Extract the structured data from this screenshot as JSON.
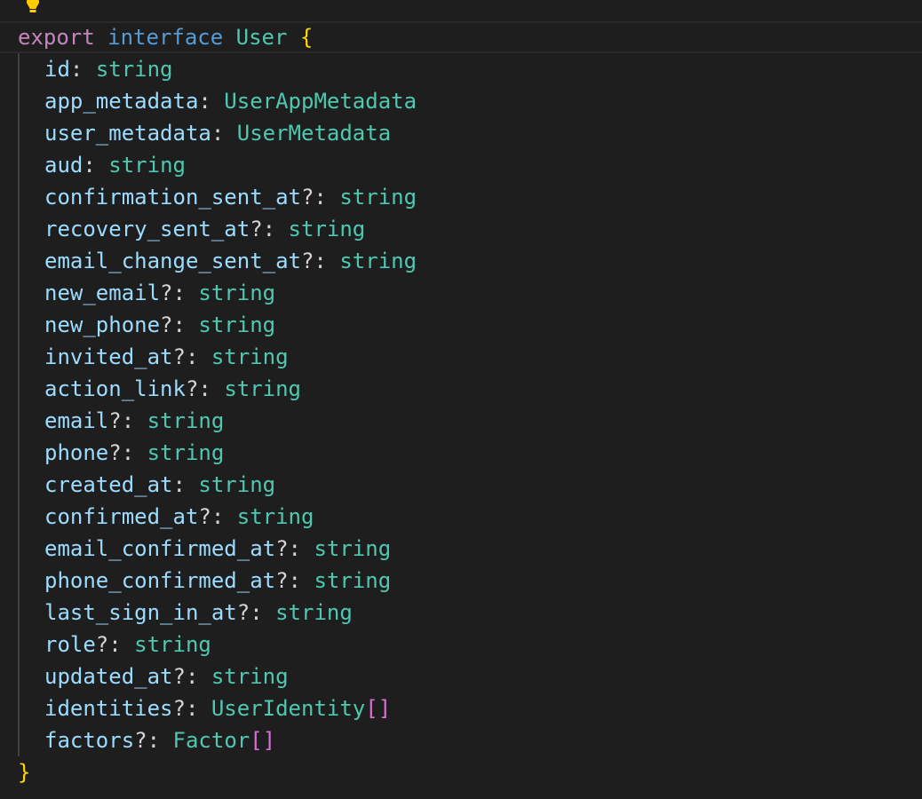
{
  "editor": {
    "lightbulb_icon": "lightbulb-icon",
    "colors": {
      "background": "#1e1e1e",
      "keyword_export": "#c586c0",
      "keyword_interface": "#569cd6",
      "type": "#4ec9b0",
      "property": "#9cdcfe",
      "brace": "#ffd700",
      "bracket": "#da70d6"
    },
    "declaration": {
      "export_kw": "export",
      "interface_kw": "interface",
      "name": "User",
      "open_brace": "{",
      "close_brace": "}"
    },
    "fields": [
      {
        "name": "id",
        "sep": ": ",
        "type": "string",
        "brackets": ""
      },
      {
        "name": "app_metadata",
        "sep": ": ",
        "type": "UserAppMetadata",
        "brackets": ""
      },
      {
        "name": "user_metadata",
        "sep": ": ",
        "type": "UserMetadata",
        "brackets": ""
      },
      {
        "name": "aud",
        "sep": ": ",
        "type": "string",
        "brackets": ""
      },
      {
        "name": "confirmation_sent_at",
        "sep": "?: ",
        "type": "string",
        "brackets": ""
      },
      {
        "name": "recovery_sent_at",
        "sep": "?: ",
        "type": "string",
        "brackets": ""
      },
      {
        "name": "email_change_sent_at",
        "sep": "?: ",
        "type": "string",
        "brackets": ""
      },
      {
        "name": "new_email",
        "sep": "?: ",
        "type": "string",
        "brackets": ""
      },
      {
        "name": "new_phone",
        "sep": "?: ",
        "type": "string",
        "brackets": ""
      },
      {
        "name": "invited_at",
        "sep": "?: ",
        "type": "string",
        "brackets": ""
      },
      {
        "name": "action_link",
        "sep": "?: ",
        "type": "string",
        "brackets": ""
      },
      {
        "name": "email",
        "sep": "?: ",
        "type": "string",
        "brackets": ""
      },
      {
        "name": "phone",
        "sep": "?: ",
        "type": "string",
        "brackets": ""
      },
      {
        "name": "created_at",
        "sep": ": ",
        "type": "string",
        "brackets": ""
      },
      {
        "name": "confirmed_at",
        "sep": "?: ",
        "type": "string",
        "brackets": ""
      },
      {
        "name": "email_confirmed_at",
        "sep": "?: ",
        "type": "string",
        "brackets": ""
      },
      {
        "name": "phone_confirmed_at",
        "sep": "?: ",
        "type": "string",
        "brackets": ""
      },
      {
        "name": "last_sign_in_at",
        "sep": "?: ",
        "type": "string",
        "brackets": ""
      },
      {
        "name": "role",
        "sep": "?: ",
        "type": "string",
        "brackets": ""
      },
      {
        "name": "updated_at",
        "sep": "?: ",
        "type": "string",
        "brackets": ""
      },
      {
        "name": "identities",
        "sep": "?: ",
        "type": "UserIdentity",
        "brackets": "[]"
      },
      {
        "name": "factors",
        "sep": "?: ",
        "type": "Factor",
        "brackets": "[]"
      }
    ]
  }
}
